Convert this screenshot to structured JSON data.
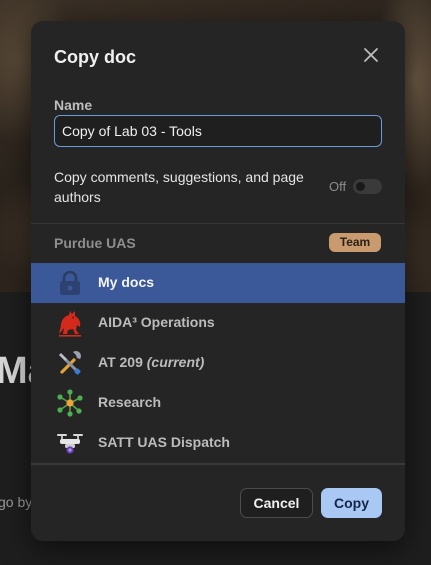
{
  "background": {
    "heading": "Ma",
    "subtext": "go by"
  },
  "dialog": {
    "title": "Copy doc",
    "name_label": "Name",
    "name_value": "Copy of Lab 03 - Tools",
    "copy_comments_label": "Copy comments, suggestions, and page authors",
    "toggle_state_label": "Off",
    "team": {
      "name": "Purdue UAS",
      "badge": "Team"
    },
    "folders": [
      {
        "label": "My docs",
        "suffix": "",
        "icon": "lock-icon",
        "selected": true
      },
      {
        "label": "AIDA³ Operations",
        "suffix": "",
        "icon": "red-horse-logo-icon",
        "selected": false
      },
      {
        "label": "AT 209 ",
        "suffix": "(current)",
        "icon": "tools-icon",
        "selected": false
      },
      {
        "label": "Research",
        "suffix": "",
        "icon": "network-nodes-icon",
        "selected": false
      },
      {
        "label": "SATT UAS Dispatch",
        "suffix": "",
        "icon": "drone-icon",
        "selected": false
      }
    ],
    "cancel_label": "Cancel",
    "copy_label": "Copy"
  },
  "colors": {
    "accent": "#3b5998",
    "primary_button": "#a9c8f4",
    "badge": "#c99a6e"
  }
}
